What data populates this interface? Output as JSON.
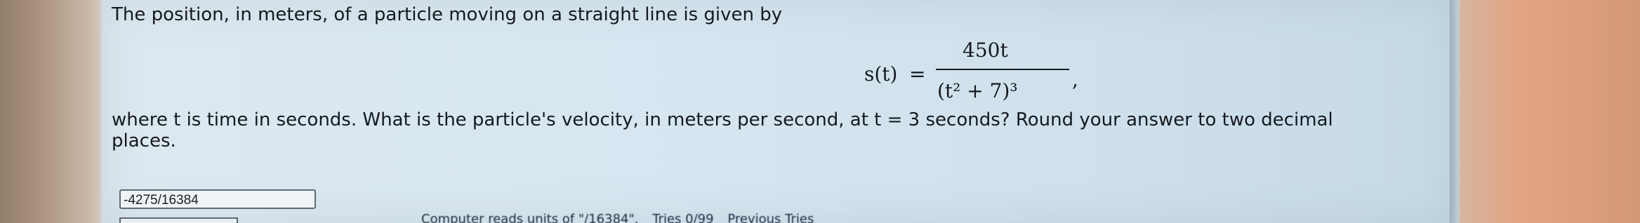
{
  "question": {
    "line1": "The position, in meters, of a particle moving on a straight line is given by",
    "formula": {
      "lhs": "s(t)",
      "equals": "=",
      "numerator": "450t",
      "denominator": "(t² + 7)³",
      "trailing": ","
    },
    "line2": "where t is time in seconds. What is the particle's velocity, in meters per second, at t = 3 seconds? Round your answer to two decimal",
    "line3": "places."
  },
  "answer": {
    "value": "-4275/16384"
  },
  "feedback": {
    "text": "Computer reads units of \"/16384\".",
    "tries": "Tries 0/99",
    "previous": "Previous Tries"
  }
}
